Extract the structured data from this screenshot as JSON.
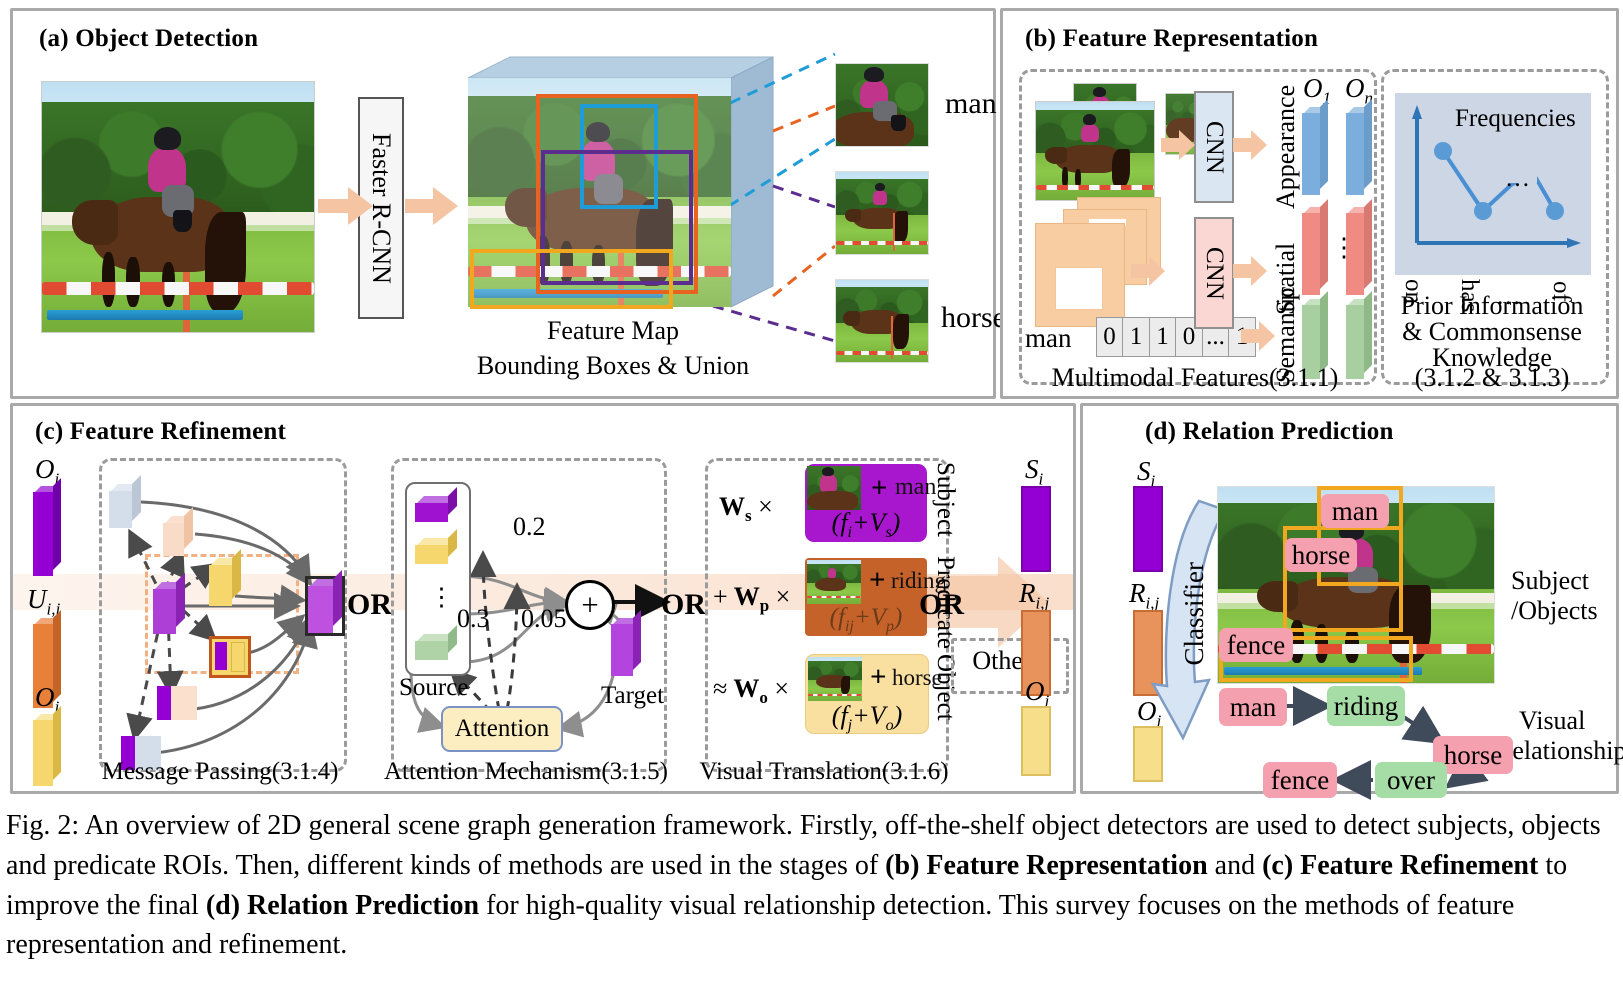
{
  "panels": {
    "a": {
      "title": "(a) Object Detection",
      "detector": "Faster R-CNN",
      "caption_line1": "Feature Map",
      "caption_line2": "Bounding Boxes & Union",
      "crop_labels": [
        "man",
        "horse"
      ]
    },
    "b": {
      "title": "(b) Feature Representation",
      "cnn_label": "CNN",
      "modality_labels": [
        "Appearance",
        "Spatial",
        "Semantic"
      ],
      "object_labels": [
        "O",
        "O"
      ],
      "object_subs": [
        "1",
        "n"
      ],
      "semantic_word": "man",
      "semantic_bits": [
        "0",
        "1",
        "1",
        "0",
        "...",
        "1"
      ],
      "ellipsis": "⋮",
      "left_caption": "Multimodal Features(3.1.1)",
      "freq_title": "Frequencies",
      "freq_ticks": [
        "on",
        "has",
        "...",
        "of"
      ],
      "right_caption_lines": [
        "Prior Information",
        "& Commonsense",
        "Knowledge",
        "(3.1.2 & 3.1.3)"
      ]
    },
    "c": {
      "title": "(c) Feature Refinement",
      "inputs": [
        {
          "sym": "O",
          "sub": "i",
          "color": "#9400D3"
        },
        {
          "sym": "U",
          "sub": "i,j",
          "color": "#E8803A"
        },
        {
          "sym": "O",
          "sub": "j",
          "color": "#F5D76E"
        }
      ],
      "sub_captions": [
        "Message Passing(3.1.4)",
        "Attention Mechanism(3.1.5)",
        "Visual Translation(3.1.6)"
      ],
      "or_labels": [
        "OR",
        "OR",
        "OR"
      ],
      "attention": {
        "source_label": "Source",
        "target_label": "Target",
        "attention_label": "Attention",
        "weights": [
          "0.2",
          "0.3",
          "0.05"
        ],
        "plus_label": "+",
        "ellipsis": "⋮"
      },
      "translation": {
        "rows": [
          {
            "weight": "W",
            "wsub": "s",
            "op": "",
            "mult": "×",
            "word": "man",
            "formula_pre": "f",
            "formula_sub": "i",
            "formula_v": "V",
            "formula_vsub": "s",
            "role": "Subject",
            "color": "#A817CD"
          },
          {
            "weight": "W",
            "wsub": "p",
            "op": "+",
            "mult": "×",
            "word": "riding",
            "formula_pre": "f",
            "formula_sub": "ij",
            "formula_v": "V",
            "formula_vsub": "p",
            "role": "Predicate",
            "color": "#C4622A"
          },
          {
            "weight": "W",
            "wsub": "o",
            "op": "≈",
            "mult": "×",
            "word": "horse",
            "formula_pre": "f",
            "formula_sub": "j",
            "formula_v": "V",
            "formula_vsub": "o",
            "role": "Object",
            "color": "#FAE0A0"
          }
        ],
        "plus_glyph": "+"
      },
      "others_label": "Others",
      "outputs": [
        {
          "sym": "S",
          "sub": "i",
          "color": "#9400D3"
        },
        {
          "sym": "R",
          "sub": "i,j",
          "color": "#E8925C"
        },
        {
          "sym": "O",
          "sub": "j",
          "color": "#F7DE8A"
        }
      ]
    },
    "d": {
      "title": "(d) Relation Prediction",
      "inputs": [
        {
          "sym": "S",
          "sub": "i",
          "color": "#9400D3"
        },
        {
          "sym": "R",
          "sub": "i,j",
          "color": "#E8925C"
        },
        {
          "sym": "O",
          "sub": "j",
          "color": "#F7DE8A"
        }
      ],
      "classifier_label": "Classifier",
      "image_tags": [
        "man",
        "horse",
        "fence"
      ],
      "right_label_1_lines": [
        "Subject",
        "/Objects"
      ],
      "right_label_2_lines": [
        "Visual",
        "Relationships"
      ],
      "graph": {
        "nodes": [
          {
            "id": "man",
            "label": "man",
            "kind": "object"
          },
          {
            "id": "riding",
            "label": "riding",
            "kind": "predicate"
          },
          {
            "id": "horse",
            "label": "horse",
            "kind": "object"
          },
          {
            "id": "over",
            "label": "over",
            "kind": "predicate"
          },
          {
            "id": "fence",
            "label": "fence",
            "kind": "object"
          }
        ],
        "edges": [
          [
            "man",
            "riding"
          ],
          [
            "riding",
            "horse"
          ],
          [
            "horse",
            "over"
          ],
          [
            "over",
            "fence"
          ]
        ],
        "object_color": "#F5A0AE",
        "predicate_color": "#A6DDA6"
      }
    }
  },
  "figure_caption": {
    "prefix": "Fig. 2: An overview of 2D general scene graph generation framework. Firstly, off-the-shelf object detectors are used to detect subjects, objects and predicate ROIs. Then, different kinds of methods are used in the stages of ",
    "bold1": "(b) Feature Representation",
    "mid1": " and ",
    "bold2": "(c) Feature Refinement",
    "mid2": " to improve the final ",
    "bold3": "(d) Relation Prediction",
    "suffix": " for high-quality visual relationship detection. This survey focuses on the methods of feature representation and refinement."
  },
  "colors": {
    "panel_border": "#a9a9a9",
    "arrow_peach": "#F5C4A3",
    "bbox_orange": "#E8631F",
    "bbox_blue": "#1E9CD7",
    "bbox_purple": "#5B2D8E",
    "bbox_yellow": "#F2A81E",
    "appearance": "#7BAEDC",
    "spatial": "#F08B84",
    "semantic": "#A8CFA0",
    "feature_map_top": "#B6CFE3"
  }
}
